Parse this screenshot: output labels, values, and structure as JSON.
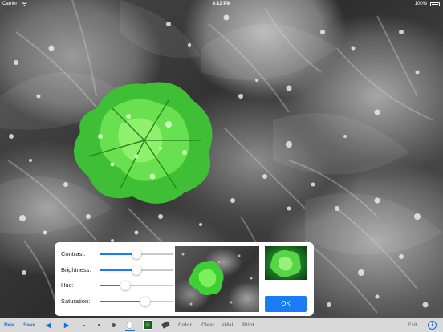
{
  "status_bar": {
    "carrier": "Carrier",
    "time": "4:13 PM",
    "battery": "100%"
  },
  "adjustments": {
    "sliders": [
      {
        "label": "Contrast:",
        "value": 0.5
      },
      {
        "label": "Brightness:",
        "value": 0.5
      },
      {
        "label": "Hue:",
        "value": 0.35
      },
      {
        "label": "Saturation:",
        "value": 0.62
      }
    ],
    "ok_label": "OK"
  },
  "toolbar": {
    "new_label": "New",
    "save_label": "Save",
    "prev_icon": "◀",
    "next_icon": "▶",
    "color_label": "Color",
    "clear_label": "Clear",
    "email_label": "eMail",
    "print_label": "Print",
    "exit_label": "Exit",
    "info_icon": "i"
  },
  "colors": {
    "accent": "#1a7cf5",
    "toolbar_bg": "#d9d9d9",
    "flower_green": "#4dd23e"
  }
}
